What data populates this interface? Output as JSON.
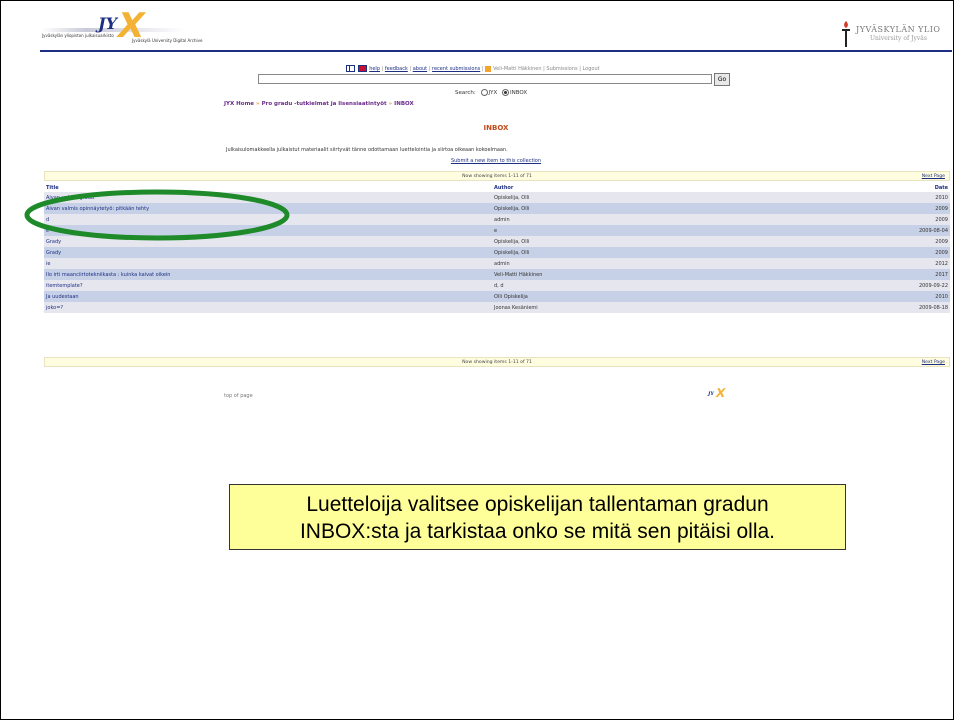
{
  "header": {
    "logo_letters": "JY",
    "logo_mark": "X",
    "logo_subtitle_1": "Jyväskylän yliopiston julkaisuarkisto",
    "logo_subtitle_2": "Jyväskylä University Digital Archive",
    "university_name": "JYVÄSKYLÄN YLIO",
    "university_sub": "University of Jyväs",
    "brand_blue": "#1d2f82",
    "brand_orange": "#f3b233"
  },
  "nav": {
    "help": "help",
    "feedback": "feedback",
    "about": "about",
    "recent_submissions": "recent submissions",
    "user": "Veli-Matti Häkkinen",
    "submissions": "Submissions",
    "logout": "Logout"
  },
  "search": {
    "value": "",
    "go_label": "Go",
    "scope_label": "Search:",
    "scope_options": [
      "JYX",
      "INBOX"
    ],
    "scope_selected": "INBOX"
  },
  "breadcrumb": [
    "JYX Home",
    "Pro gradu -tutkielmat ja lisensiaatintyöt",
    "INBOX"
  ],
  "collection": {
    "title": "INBOX",
    "description": "Julkaisulomakkeella julkaistut materiaalit siirtyvät tänne odottamaan luettelointia ja siirtoa oikeaan kokoelmaan.",
    "submit_link": "Submit a new item to this collection"
  },
  "pager": {
    "showing": "Now showing items 1-11 of 71",
    "next": "Next Page"
  },
  "table": {
    "columns": [
      "Title",
      "Author",
      "Date"
    ],
    "rows": [
      {
        "title": "Aivan valmis gradu",
        "author": "Opiskelija, Olli",
        "date": "2010"
      },
      {
        "title": "Aivan valmis opinnäytetyö: pitkään tehty",
        "author": "Opiskelija, Olli",
        "date": "2009"
      },
      {
        "title": "d",
        "author": "admin",
        "date": "2009"
      },
      {
        "title": "e",
        "author": "e",
        "date": "2009-08-04"
      },
      {
        "title": "Grady",
        "author": "Opiskelija, Olli",
        "date": "2009"
      },
      {
        "title": "Grady",
        "author": "Opiskelija, Olli",
        "date": "2009"
      },
      {
        "title": "ie",
        "author": "admin",
        "date": "2012"
      },
      {
        "title": "Ilo irti maanciirtotekniikasta : kuinka kaivat oikein",
        "author": "Veli-Matti Häkkinen",
        "date": "2017"
      },
      {
        "title": "itemtemplate?",
        "author": "d, d",
        "date": "2009-09-22"
      },
      {
        "title": "Ja uudestaan",
        "author": "Olli Opiskelija",
        "date": "2010"
      },
      {
        "title": "joko=?",
        "author": "Joonas Kesäniemi",
        "date": "2009-08-18"
      }
    ]
  },
  "footer": {
    "top_of_page": "top of page",
    "logo_letters": "JY",
    "logo_mark": "X"
  },
  "annotation": {
    "ring_color": "#1e8a2a",
    "callout_line_1": "Luetteloija valitsee opiskelijan tallentaman gradun",
    "callout_line_2": "INBOX:sta ja tarkistaa onko se mitä sen pitäisi olla.",
    "callout_color": "#ffff99"
  }
}
